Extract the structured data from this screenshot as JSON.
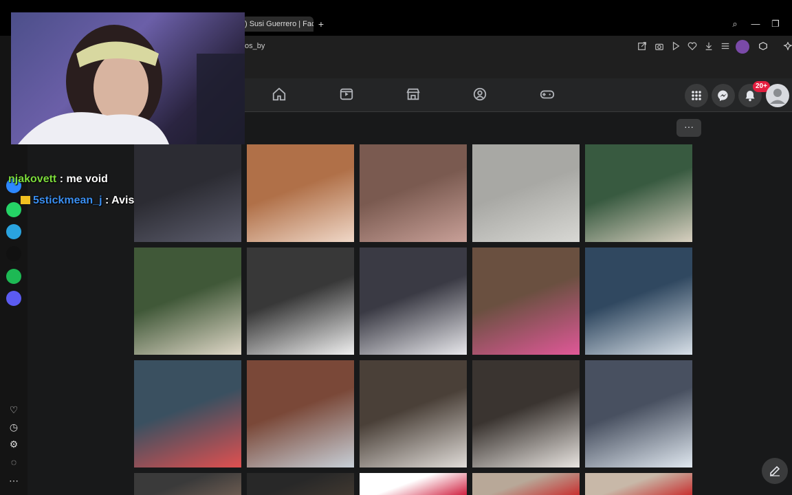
{
  "browser": {
    "tab_title": ") Susi Guerrero | Face",
    "new_tab": "+",
    "url_fragment": "os_by"
  },
  "window_controls": {
    "search": "⌕",
    "minimize": "—",
    "restore": "❐"
  },
  "toolbar_icons": [
    "share-icon",
    "camera-icon",
    "play-icon",
    "heart-icon",
    "download-icon",
    "menu-icon",
    "profile-icon",
    "extension-icon",
    "pin-icon"
  ],
  "facebook": {
    "nav_icons": [
      "home-icon",
      "video-icon",
      "marketplace-icon",
      "groups-icon",
      "gaming-icon"
    ],
    "notifications_badge": "20+",
    "more_label": "···"
  },
  "chat": [
    {
      "user": "njakovett",
      "sep": " : ",
      "message": "me void"
    },
    {
      "user": "5stickmean_j",
      "sep": " : ",
      "message": "Avisa del scrimer"
    }
  ],
  "sidebar": {
    "apps": [
      {
        "name": "messenger-icon",
        "color": "#2d88ff"
      },
      {
        "name": "whatsapp-icon",
        "color": "#25d366"
      },
      {
        "name": "telegram-icon",
        "color": "#2aa3df"
      },
      {
        "name": "tiktok-icon",
        "color": "#111111"
      },
      {
        "name": "spotify-icon",
        "color": "#1db954"
      },
      {
        "name": "media-player-icon",
        "color": "#5b5bf0"
      }
    ],
    "bottom": [
      "heart-icon",
      "clock-icon",
      "gear-icon",
      "bulb-icon",
      "more-icon"
    ]
  },
  "photos": [
    {
      "label": "plush-toy",
      "colors": [
        "#2c2c33",
        "#5d5e6e"
      ]
    },
    {
      "label": "baby",
      "colors": [
        "#b07048",
        "#f0d8c8"
      ]
    },
    {
      "label": "two-kids",
      "colors": [
        "#7a5a50",
        "#c8a098"
      ]
    },
    {
      "label": "beach-family",
      "colors": [
        "#a8a8a4",
        "#d8d8d4"
      ]
    },
    {
      "label": "girls-table",
      "colors": [
        "#385a40",
        "#d8d0c0"
      ]
    },
    {
      "label": "cintas-stand",
      "colors": [
        "#405838",
        "#e0d8c8"
      ]
    },
    {
      "label": "jewelry-display",
      "colors": [
        "#383838",
        "#f0f0f0"
      ]
    },
    {
      "label": "gotita-stand",
      "colors": [
        "#3a3a44",
        "#e8e8ec"
      ]
    },
    {
      "label": "pink-stand",
      "colors": [
        "#6a5040",
        "#e05898"
      ]
    },
    {
      "label": "blue-table",
      "colors": [
        "#304860",
        "#d8e0e8"
      ]
    },
    {
      "label": "students-display",
      "colors": [
        "#3a5060",
        "#e05050"
      ]
    },
    {
      "label": "brick-school",
      "colors": [
        "#7a4838",
        "#c8d0d8"
      ]
    },
    {
      "label": "necklace-table",
      "colors": [
        "#4a4038",
        "#e0dcd8"
      ]
    },
    {
      "label": "girls-necklaces",
      "colors": [
        "#3a3430",
        "#e8e4e0"
      ]
    },
    {
      "label": "student-desk",
      "colors": [
        "#485060",
        "#e0e8f0"
      ]
    },
    {
      "label": "partial-1",
      "colors": [
        "#3a3a3a",
        "#6a5a50"
      ]
    },
    {
      "label": "partial-2",
      "colors": [
        "#282828",
        "#403830"
      ]
    },
    {
      "label": "partial-3",
      "colors": [
        "#ffffff",
        "#d02040"
      ]
    },
    {
      "label": "partial-4",
      "colors": [
        "#b8a898",
        "#c83030"
      ]
    },
    {
      "label": "partial-5",
      "colors": [
        "#c8b8a8",
        "#c83030"
      ]
    }
  ]
}
